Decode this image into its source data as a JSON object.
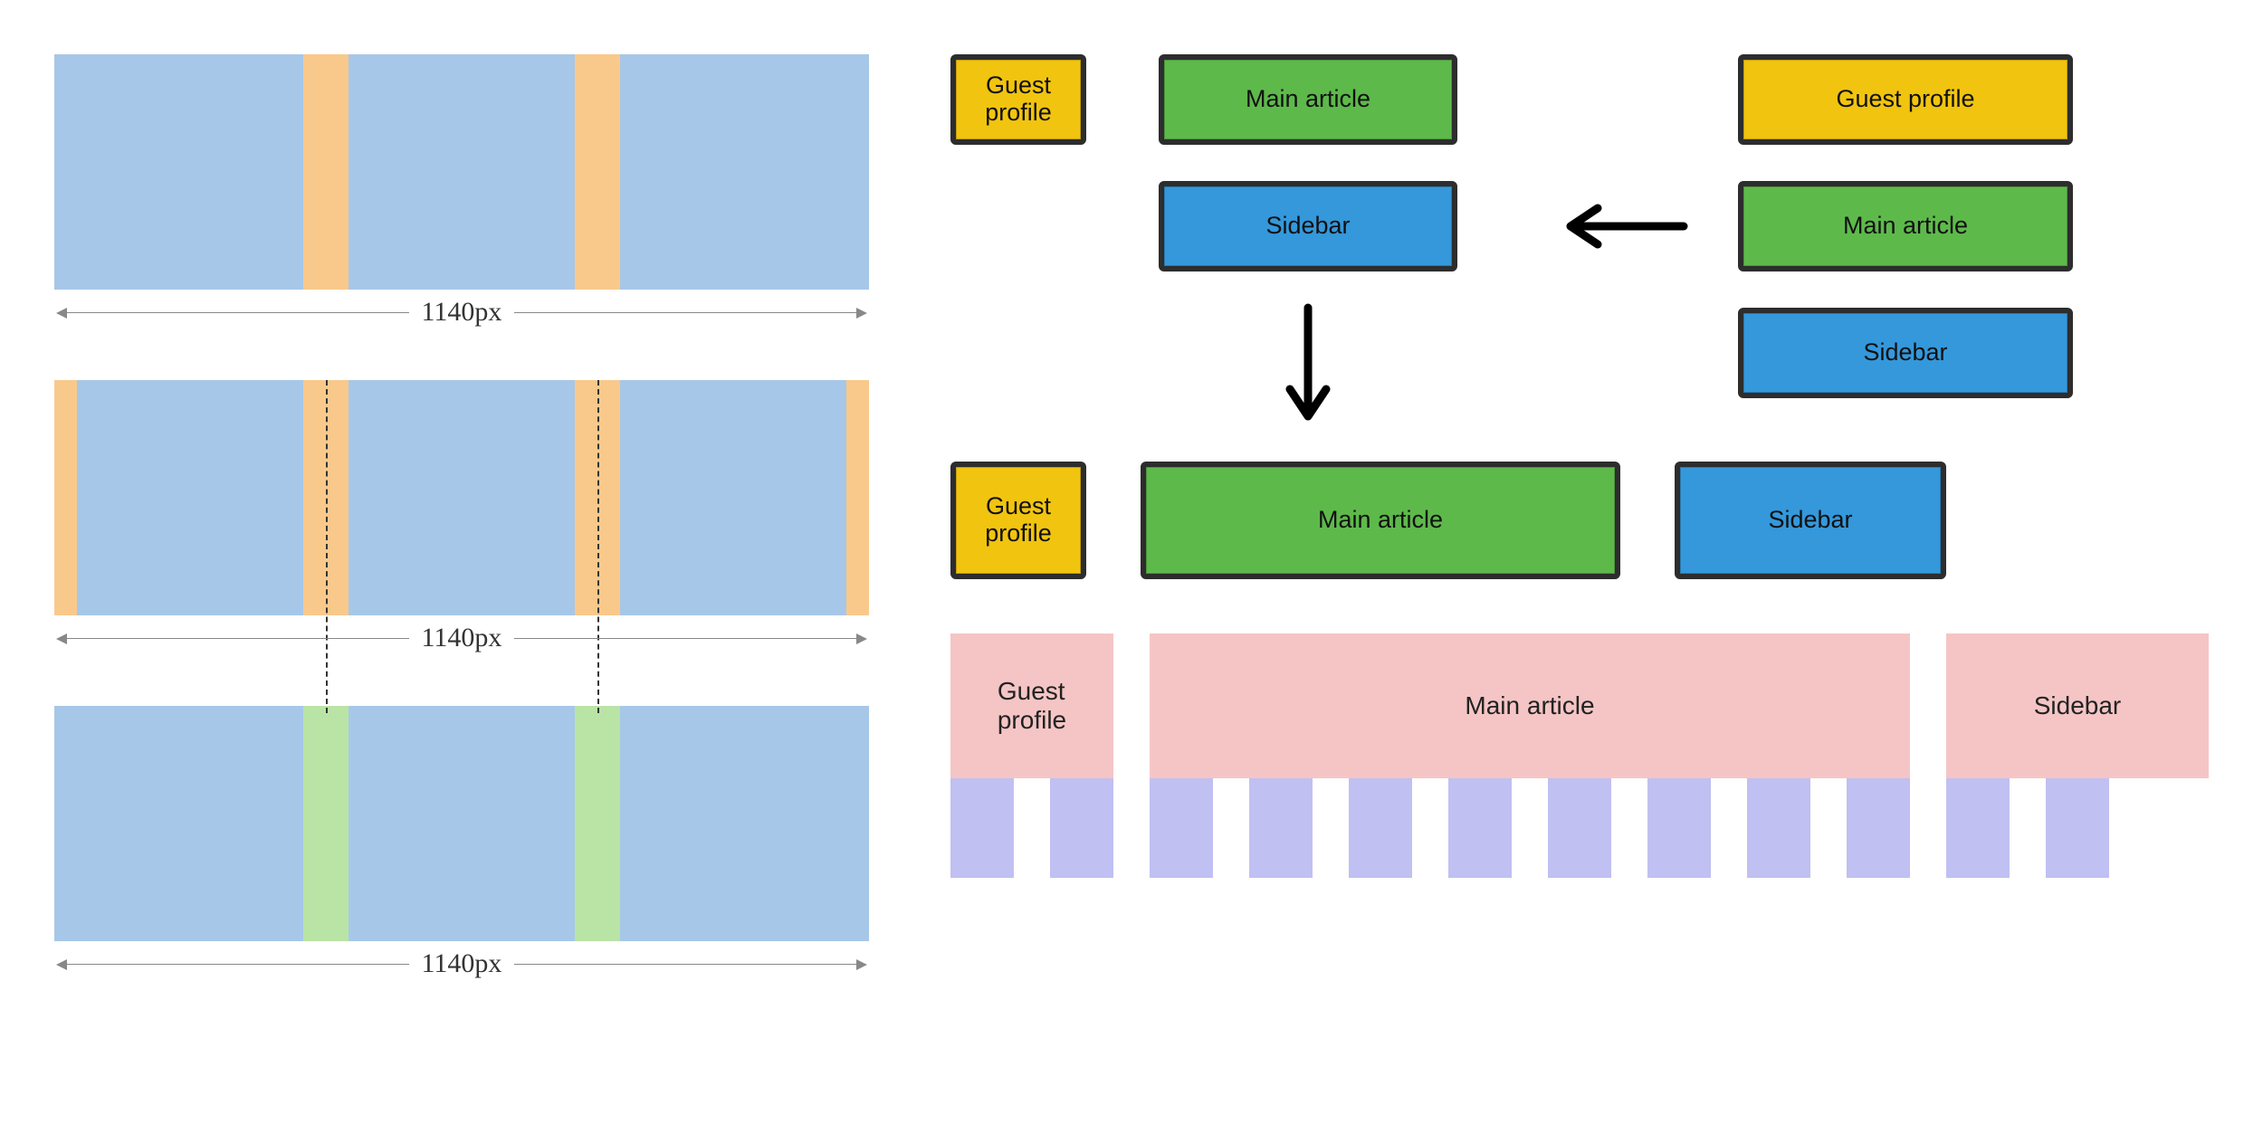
{
  "left": {
    "rows": [
      {
        "dim_label": "1140px"
      },
      {
        "dim_label": "1140px"
      },
      {
        "dim_label": "1140px"
      }
    ]
  },
  "sketch": {
    "group_topleft": {
      "guest": "Guest\nprofile",
      "main": "Main article",
      "sidebar": "Sidebar"
    },
    "group_right": {
      "guest": "Guest profile",
      "main": "Main article",
      "sidebar": "Sidebar"
    },
    "group_bottom": {
      "guest": "Guest\nprofile",
      "main": "Main article",
      "sidebar": "Sidebar"
    }
  },
  "render": {
    "guest": "Guest\nprofile",
    "main": "Main article",
    "sidebar": "Sidebar"
  },
  "colors": {
    "col_blue": "#a7c7e8",
    "col_orange": "#f9c98b",
    "col_green": "#b9e4a5",
    "box_yellow": "#f1c40f",
    "box_green": "#5eb94b",
    "box_blue": "#3498db",
    "render_pink": "#f5c5c5",
    "render_lilac": "#c0c0f2"
  }
}
